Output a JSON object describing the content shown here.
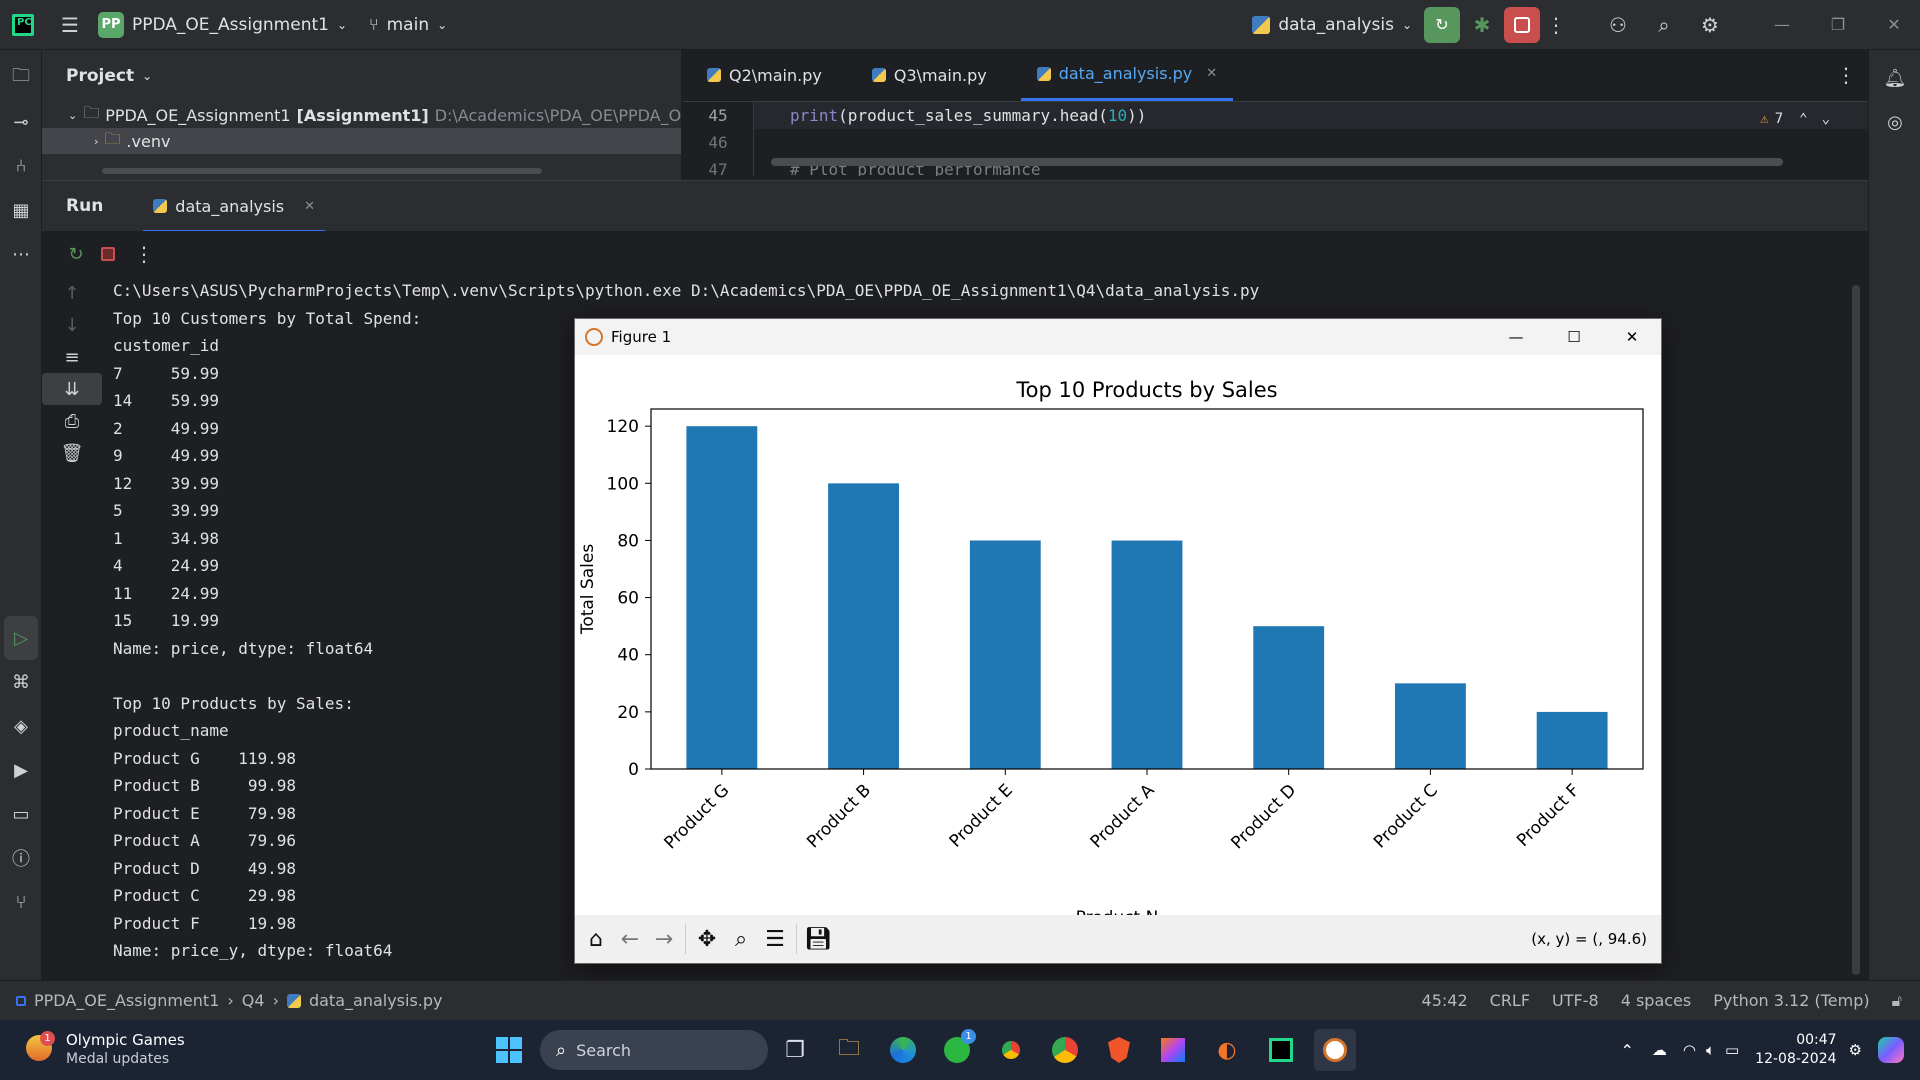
{
  "titlebar": {
    "project_badge": "PP",
    "project_name": "PPDA_OE_Assignment1",
    "branch": "main",
    "run_config": "data_analysis"
  },
  "project_panel": {
    "title": "Project",
    "root_name": "PPDA_OE_Assignment1",
    "root_module": "[Assignment1]",
    "root_path": "D:\\Academics\\PDA_OE\\PPDA_OE",
    "venv": ".venv"
  },
  "editor": {
    "tabs": [
      {
        "label": "Q2\\main.py"
      },
      {
        "label": "Q3\\main.py"
      },
      {
        "label": "data_analysis.py"
      }
    ],
    "warnings": "7",
    "lines": [
      {
        "num": "45",
        "code_fn": "print",
        "code_rest_a": "(product_sales_summary.head(",
        "code_num": "10",
        "code_rest_b": "))"
      },
      {
        "num": "46",
        "code": ""
      },
      {
        "num": "47",
        "code": "# Plot product performance"
      }
    ]
  },
  "run_panel": {
    "title": "Run",
    "tab_label": "data_analysis"
  },
  "console_lines": [
    "C:\\Users\\ASUS\\PycharmProjects\\Temp\\.venv\\Scripts\\python.exe D:\\Academics\\PDA_OE\\PPDA_OE_Assignment1\\Q4\\data_analysis.py",
    "Top 10 Customers by Total Spend:",
    "customer_id",
    "7     59.99",
    "14    59.99",
    "2     49.99",
    "9     49.99",
    "12    39.99",
    "5     39.99",
    "1     34.98",
    "4     24.99",
    "11    24.99",
    "15    19.99",
    "Name: price, dtype: float64",
    "",
    "Top 10 Products by Sales:",
    "product_name",
    "Product G    119.98",
    "Product B     99.98",
    "Product E     79.98",
    "Product A     79.96",
    "Product D     49.98",
    "Product C     29.98",
    "Product F     19.98",
    "Name: price_y, dtype: float64"
  ],
  "figure": {
    "window_title": "Figure 1",
    "coord_readout": "(x, y) = (, 94.6)"
  },
  "chart_data": {
    "type": "bar",
    "title": "Top 10 Products by Sales",
    "xlabel": "Product N",
    "ylabel": "Total Sales",
    "categories": [
      "Product G",
      "Product B",
      "Product E",
      "Product A",
      "Product D",
      "Product C",
      "Product F"
    ],
    "values": [
      119.98,
      99.98,
      79.98,
      79.96,
      49.98,
      29.98,
      19.98
    ],
    "ylim": [
      0,
      126
    ],
    "yticks": [
      "0",
      "20",
      "40",
      "60",
      "80",
      "100",
      "120"
    ],
    "bar_color": "#1f77b4",
    "grid": false,
    "legend": "none"
  },
  "statusbar": {
    "crumb_project": "PPDA_OE_Assignment1",
    "crumb_folder": "Q4",
    "crumb_file": "data_analysis.py",
    "position": "45:42",
    "line_sep": "CRLF",
    "encoding": "UTF-8",
    "indent": "4 spaces",
    "interpreter": "Python 3.12 (Temp)"
  },
  "taskbar": {
    "news_title": "Olympic Games",
    "news_sub": "Medal updates",
    "news_badge": "1",
    "search_label": "Search",
    "whatsapp_badge": "1",
    "time": "00:47",
    "date": "12-08-2024"
  },
  "colors": {
    "accent": "#3574f0",
    "run_green": "#57965c",
    "stop_red": "#c94f4f",
    "bar_blue": "#1f77b4"
  }
}
